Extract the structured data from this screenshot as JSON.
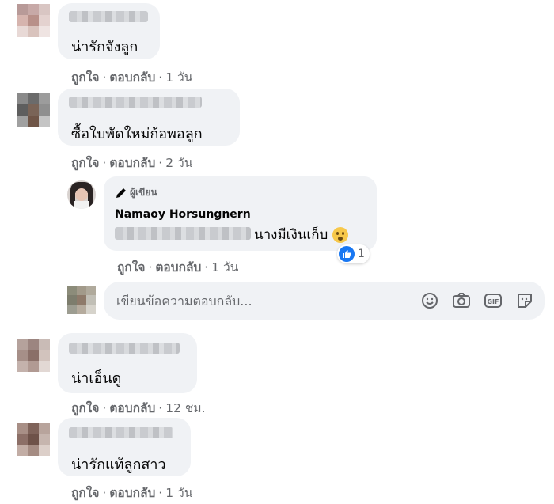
{
  "comments": [
    {
      "text": "น่ารักจังลูก",
      "like": "ถูกใจ",
      "reply": "ตอบกลับ",
      "time": "1 วัน"
    },
    {
      "text": "ซื้อใบพัดใหม่ก้อพอลูก",
      "like": "ถูกใจ",
      "reply": "ตอบกลับ",
      "time": "2 วัน"
    },
    {
      "text": "น่าเอ็นดู",
      "like": "ถูกใจ",
      "reply": "ตอบกลับ",
      "time": "12 ชม."
    },
    {
      "text": "น่ารักแท้ลูกสาว",
      "like": "ถูกใจ",
      "reply": "ตอบกลับ",
      "time": "1 วัน"
    }
  ],
  "author_reply": {
    "badge": "ผู้เขียน",
    "name": "Namaoy Horsungnern",
    "text": "นางมีเงินเก็บ",
    "like": "ถูกใจ",
    "reply": "ตอบกลับ",
    "time": "1 วัน",
    "reaction_count": "1"
  },
  "reply_box": {
    "placeholder": "เขียนข้อความตอบกลับ...",
    "icons": [
      "smiley-icon",
      "camera-icon",
      "gif-icon",
      "sticker-icon"
    ]
  },
  "colors": {
    "bubble": "#f0f2f5",
    "secondary_text": "#65676b",
    "like_blue": "#1877f2"
  }
}
